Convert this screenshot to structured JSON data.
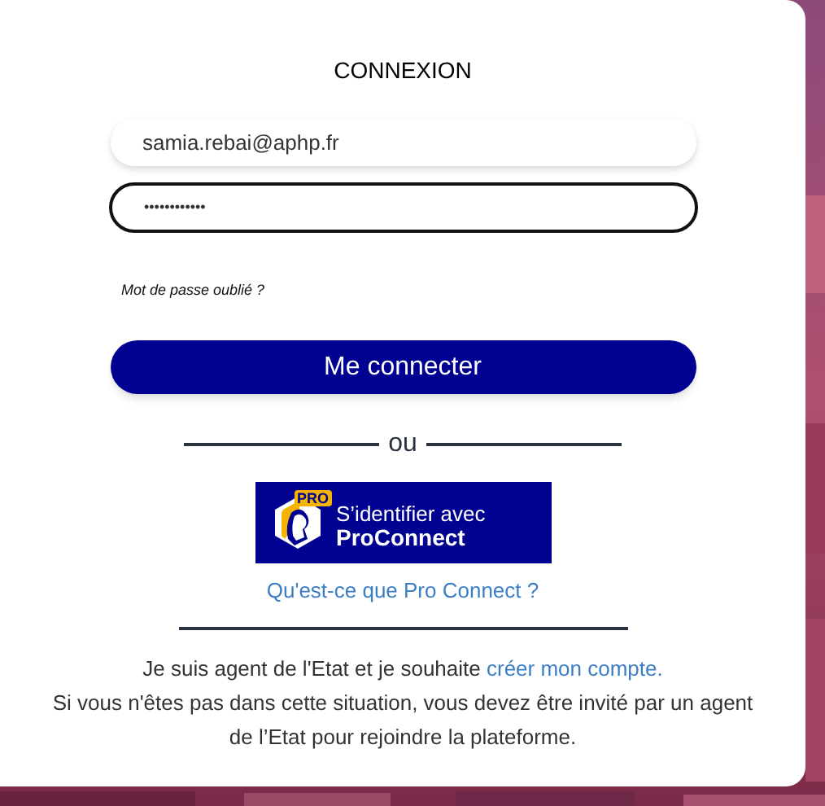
{
  "title": "CONNEXION",
  "email_field": {
    "value": "samia.rebai@aphp.fr",
    "focused": false
  },
  "password_field": {
    "value": "••••••••••••",
    "focused": true
  },
  "forgot_link": "Mot de passe oublié ?",
  "login_button": "Me connecter",
  "separator": "ou",
  "proconnect_button": {
    "badge": "PRO",
    "line_1": "S’identifier avec",
    "line_2": "ProConnect"
  },
  "proconnect_info_link": "Qu'est-ce que Pro Connect ?",
  "account_note": {
    "text": "Je suis agent de l'Etat et je souhaite ",
    "link": "créer mon compte."
  },
  "invite_note": "Si vous n'êtes pas dans cette situation, vous devez être invité par un agent de l’Etat pour rejoindre la plateforme."
}
